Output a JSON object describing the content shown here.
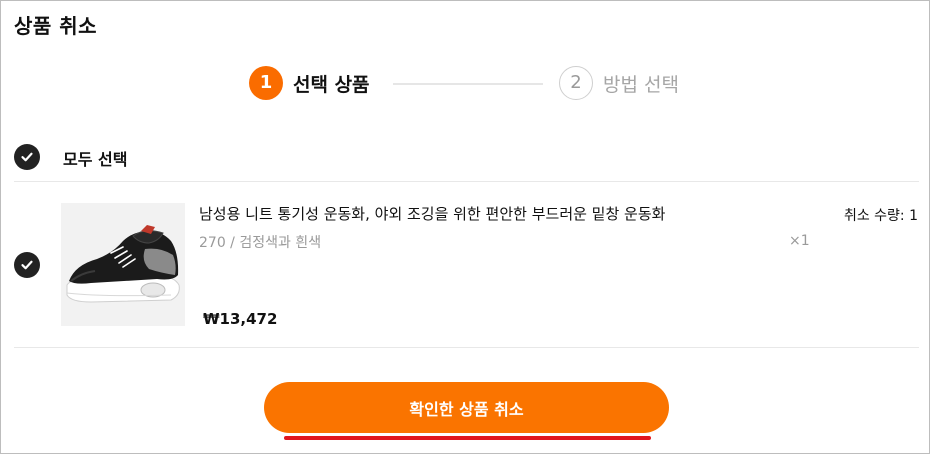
{
  "dialog": {
    "title": "상품 취소"
  },
  "steps": [
    {
      "number": "1",
      "label": "선택 상품",
      "active": true
    },
    {
      "number": "2",
      "label": "방법 선택",
      "active": false
    }
  ],
  "select_all": {
    "label": "모두 선택",
    "checked": true
  },
  "product": {
    "name": "남성용 니트 통기성 운동화, 야외 조깅을 위한 편안한 부드러운 밑창 운동화",
    "option": "270 / 검정색과 흰색",
    "quantity": "×1",
    "cancel_quantity": "취소 수량: 1",
    "price": "₩13,472",
    "checked": true,
    "image_icon": "black-sneaker-image"
  },
  "confirm_button": {
    "label": "확인한 상품 취소"
  },
  "colors": {
    "accent": "#fa7400",
    "highlight_underline": "#e0161e",
    "check_fill": "#222222"
  }
}
